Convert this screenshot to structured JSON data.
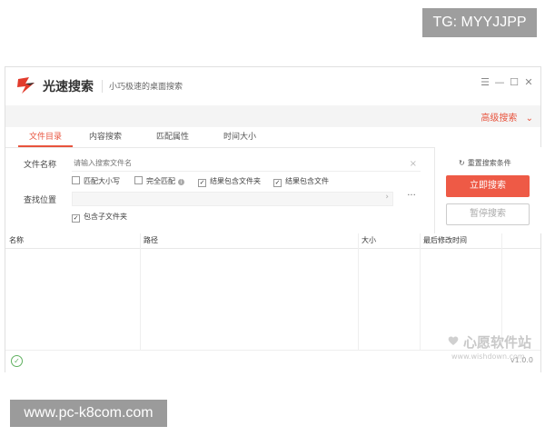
{
  "overlays": {
    "tg_badge": "TG: MYYJJPP",
    "site_badge": "www.pc-k8com.com"
  },
  "app": {
    "title": "光速搜索",
    "subtitle": "小巧极速的桌面搜索",
    "window_controls": [
      "menu-icon",
      "minimize-icon",
      "maximize-icon",
      "close-icon"
    ]
  },
  "advanced": {
    "label": "高级搜索"
  },
  "tabs": [
    {
      "label": "文件目录",
      "active": true
    },
    {
      "label": "内容搜索",
      "active": false
    },
    {
      "label": "匹配属性",
      "active": false
    },
    {
      "label": "时间大小",
      "active": false
    }
  ],
  "form": {
    "name_label": "文件名称",
    "name_placeholder": "请输入搜索文件名",
    "name_value": "",
    "options": [
      {
        "label": "匹配大小写",
        "checked": false
      },
      {
        "label": "完全匹配",
        "checked": false,
        "info": true
      },
      {
        "label": "结果包含文件夹",
        "checked": true
      },
      {
        "label": "结果包含文件",
        "checked": true
      }
    ],
    "location_label": "查找位置",
    "location_value": "",
    "browse_label": "···",
    "subfolder_option": {
      "label": "包含子文件夹",
      "checked": true
    }
  },
  "actions": {
    "reset_label": "重置搜索条件",
    "search_label": "立即搜索",
    "pause_label": "暂停搜索"
  },
  "table": {
    "columns": [
      "名称",
      "路径",
      "大小",
      "最后修改时间"
    ],
    "rows": []
  },
  "status": {
    "version": "v1.0.0"
  },
  "watermark": {
    "main": "心愿软件站",
    "sub": "www.wishdown.com"
  },
  "colors": {
    "accent": "#e8533d",
    "search_button": "#ee5a46",
    "status_ok": "#5fb05f"
  }
}
